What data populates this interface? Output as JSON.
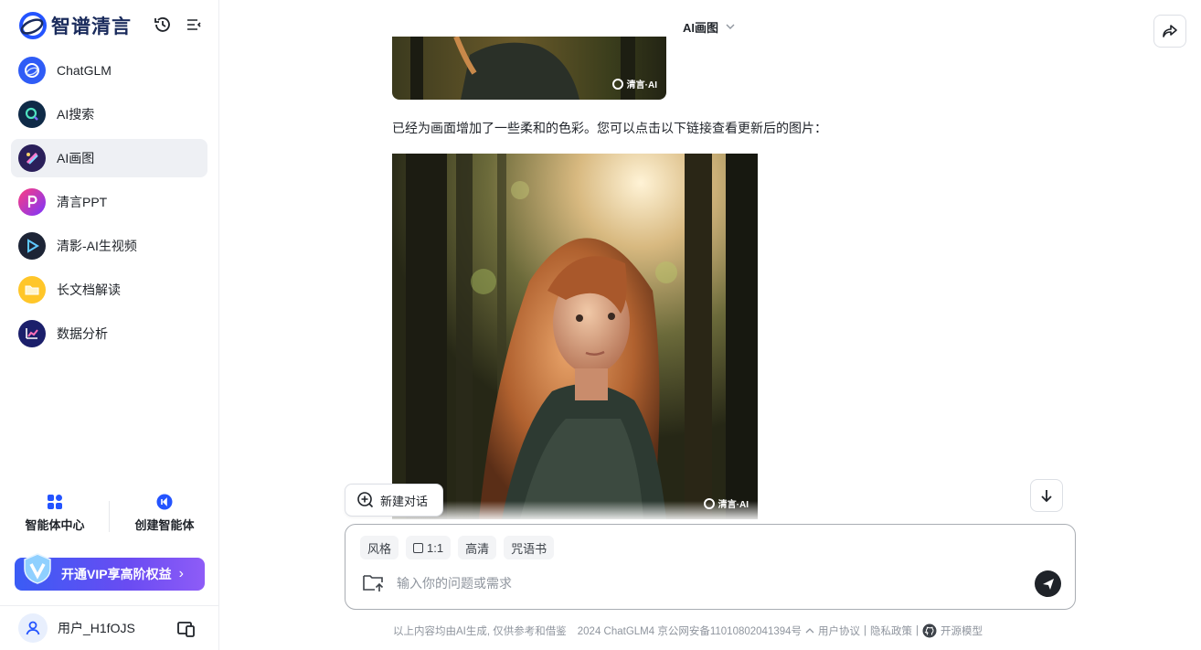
{
  "brand": {
    "name": "智谱清言"
  },
  "sidebar": {
    "items": [
      {
        "label": "ChatGLM",
        "icon": "chatglm-icon"
      },
      {
        "label": "AI搜索",
        "icon": "ai-search-icon"
      },
      {
        "label": "AI画图",
        "icon": "ai-drawing-icon",
        "active": true
      },
      {
        "label": "清言PPT",
        "icon": "ppt-icon"
      },
      {
        "label": "清影-AI生视频",
        "icon": "video-icon"
      },
      {
        "label": "长文档解读",
        "icon": "folder-icon"
      },
      {
        "label": "数据分析",
        "icon": "chart-icon"
      }
    ],
    "agent_center": "智能体中心",
    "create_agent": "创建智能体",
    "vip_label": "开通VIP享高阶权益",
    "user_name": "用户_H1fOJS"
  },
  "header": {
    "title": "AI画图"
  },
  "chat": {
    "message_text": "已经为画面增加了一些柔和的色彩。您可以点击以下链接查看更新后的图片：",
    "watermark": "清言·AI"
  },
  "actions": {
    "new_chat": "新建对话"
  },
  "composer": {
    "chips": {
      "style": "风格",
      "ratio": "1:1",
      "hd": "高清",
      "spellbook": "咒语书"
    },
    "placeholder": "输入你的问题或需求"
  },
  "footer": {
    "disclaimer": "以上内容均由AI生成, 仅供参考和借鉴",
    "icp": "2024 ChatGLM4 京公网安备11010802041394号",
    "user_agreement": "用户协议",
    "privacy": "隐私政策",
    "open_model": "开源模型"
  },
  "colors": {
    "accent": "#2454ff",
    "vip_start": "#3a5cf5",
    "vip_end": "#8e5cf7",
    "send": "#1f2329"
  }
}
